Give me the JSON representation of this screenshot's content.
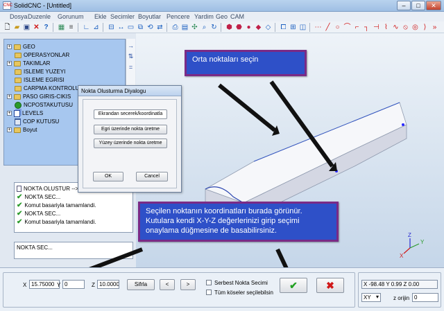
{
  "window": {
    "title": "SolidCNC - [Untitled]",
    "icon_text": "CNC",
    "minimize": "–",
    "maximize": "□",
    "close": "✕"
  },
  "menu": [
    "Dosya",
    "Duzenle",
    "Gorunum",
    "Ekle",
    "Secimler",
    "Boyutlar",
    "Pencere",
    "Yardim",
    "Geo",
    "CAM"
  ],
  "tree": [
    {
      "label": "GEO",
      "expander": "+"
    },
    {
      "label": "OPERASYONLAR",
      "expander": ""
    },
    {
      "label": "TAKIMLAR",
      "expander": "+"
    },
    {
      "label": "ISLEME YUZEYI",
      "expander": ""
    },
    {
      "label": "ISLEME EGRISI",
      "expander": ""
    },
    {
      "label": "CARPMA KONTROLU",
      "expander": ""
    },
    {
      "label": "PASO GIRIS-CIKIS",
      "expander": "+"
    },
    {
      "label": "NCPOSTAKUTUSU",
      "expander": ""
    },
    {
      "label": "LEVELS",
      "expander": "+"
    },
    {
      "label": "COP KUTUSU",
      "expander": ""
    },
    {
      "label": "Boyut",
      "expander": "+"
    }
  ],
  "side_icons": [
    "→",
    "⇅",
    "="
  ],
  "dialog": {
    "title": "Nokta Olusturma Diyalogu",
    "btn_screen": "Ekrandan secerek/koordinatla",
    "btn_curve": "Egri üzerinde nokta üretme",
    "btn_surface": "Yüzey üzerinde nokta üretme",
    "ok": "OK",
    "cancel": "Cancel"
  },
  "log": [
    {
      "text": "NOKTA OLUSTUR -->",
      "ok": false
    },
    {
      "text": "NOKTA SEC...",
      "ok": true
    },
    {
      "text": "Komut basariyla tamamlandi.",
      "ok": true
    },
    {
      "text": "NOKTA SEC...",
      "ok": true
    },
    {
      "text": "Komut basariyla tamamlandi.",
      "ok": true
    }
  ],
  "command_line": "NOKTA SEC...",
  "callouts": {
    "top": "Orta noktaları seçin",
    "bottom": "Seçilen noktanın koordinatları burada görünür. Kutulara kendi X-Y-Z değerlerinizi girip seçimi onaylama düğmesine de basabilirsiniz."
  },
  "axis": {
    "x": "X",
    "y": "Y",
    "z": "Z"
  },
  "coords": {
    "x_label": "X",
    "x_value": "15.75000",
    "y_label": "Y",
    "y_value": "0",
    "z_label": "Z",
    "z_value": "10.0000",
    "reset": "Sifrla",
    "prev": "<",
    "next": ">",
    "free_select": "Serbest Nokta Secimi",
    "all_corners": "Tüm köseler seçilebilsin",
    "confirm": "✔",
    "cancel": "✖"
  },
  "status": {
    "readout": "X -98.48  Y 0.99  Z 0.00",
    "plane": "XY",
    "z_origin_label": "z orijin",
    "z_origin": "0"
  },
  "colors": {
    "callout_fill": "#2e50c8",
    "callout_border": "#7a2a86",
    "confirm": "#22a022",
    "cancel": "#d01818"
  }
}
